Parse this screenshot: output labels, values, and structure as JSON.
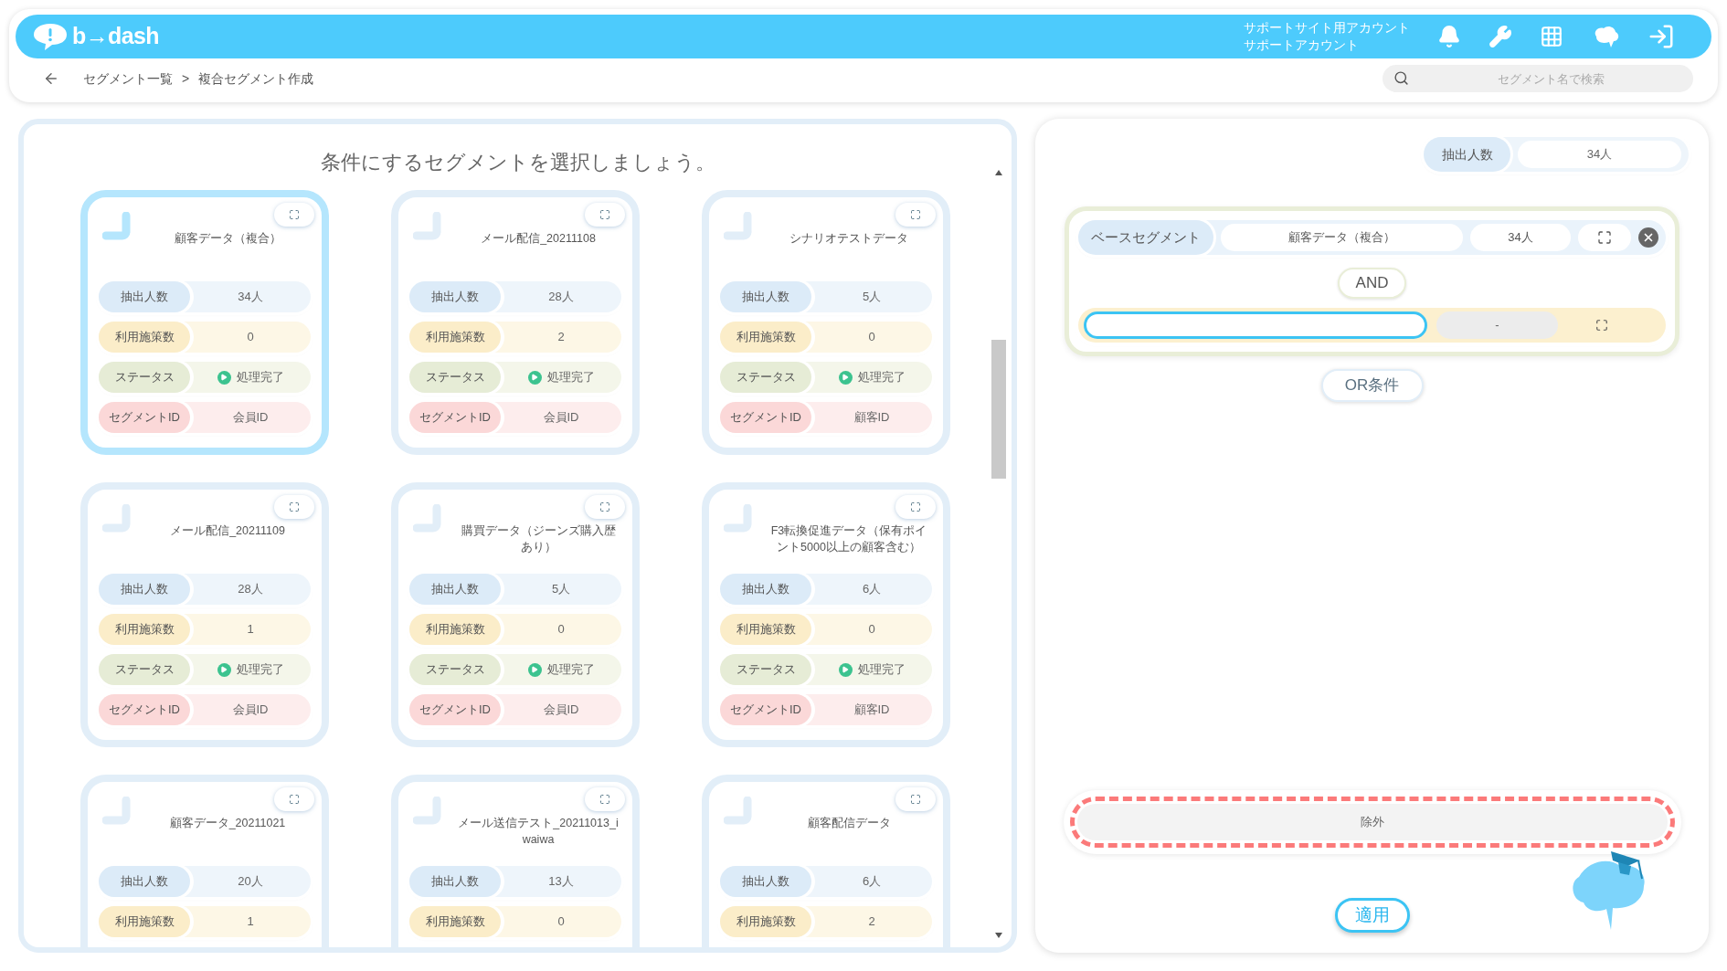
{
  "header": {
    "logo": "b→dash",
    "account_lines": [
      "サポートサイト用アカウント",
      "サポートアカウント"
    ]
  },
  "breadcrumb": {
    "items": [
      "セグメント一覧",
      "複合セグメント作成"
    ],
    "separator": ">"
  },
  "search": {
    "placeholder": "セグメント名で検索"
  },
  "segment_picker": {
    "title": "条件にするセグメントを選択しましょう。",
    "cards": [
      {
        "name": "顧客データ（複合）",
        "selected": true,
        "rows": [
          {
            "kind": "count",
            "label": "抽出人数",
            "value": "34人"
          },
          {
            "kind": "measures",
            "label": "利用施策数",
            "value": "0"
          },
          {
            "kind": "status",
            "label": "ステータス",
            "value": "処理完了"
          },
          {
            "kind": "id",
            "label": "セグメントID",
            "value": "会員ID"
          }
        ]
      },
      {
        "name": "メール配信_20211108",
        "selected": false,
        "rows": [
          {
            "kind": "count",
            "label": "抽出人数",
            "value": "28人"
          },
          {
            "kind": "measures",
            "label": "利用施策数",
            "value": "2"
          },
          {
            "kind": "status",
            "label": "ステータス",
            "value": "処理完了"
          },
          {
            "kind": "id",
            "label": "セグメントID",
            "value": "会員ID"
          }
        ]
      },
      {
        "name": "シナリオテストデータ",
        "selected": false,
        "rows": [
          {
            "kind": "count",
            "label": "抽出人数",
            "value": "5人"
          },
          {
            "kind": "measures",
            "label": "利用施策数",
            "value": "0"
          },
          {
            "kind": "status",
            "label": "ステータス",
            "value": "処理完了"
          },
          {
            "kind": "id",
            "label": "セグメントID",
            "value": "顧客ID"
          }
        ]
      },
      {
        "name": "メール配信_20211109",
        "selected": false,
        "rows": [
          {
            "kind": "count",
            "label": "抽出人数",
            "value": "28人"
          },
          {
            "kind": "measures",
            "label": "利用施策数",
            "value": "1"
          },
          {
            "kind": "status",
            "label": "ステータス",
            "value": "処理完了"
          },
          {
            "kind": "id",
            "label": "セグメントID",
            "value": "会員ID"
          }
        ]
      },
      {
        "name": "購買データ（ジーンズ購入歴あり）",
        "selected": false,
        "rows": [
          {
            "kind": "count",
            "label": "抽出人数",
            "value": "5人"
          },
          {
            "kind": "measures",
            "label": "利用施策数",
            "value": "0"
          },
          {
            "kind": "status",
            "label": "ステータス",
            "value": "処理完了"
          },
          {
            "kind": "id",
            "label": "セグメントID",
            "value": "会員ID"
          }
        ]
      },
      {
        "name": "F3転換促進データ（保有ポイント5000以上の顧客含む）",
        "selected": false,
        "rows": [
          {
            "kind": "count",
            "label": "抽出人数",
            "value": "6人"
          },
          {
            "kind": "measures",
            "label": "利用施策数",
            "value": "0"
          },
          {
            "kind": "status",
            "label": "ステータス",
            "value": "処理完了"
          },
          {
            "kind": "id",
            "label": "セグメントID",
            "value": "顧客ID"
          }
        ]
      },
      {
        "name": "顧客データ_20211021",
        "selected": false,
        "rows": [
          {
            "kind": "count",
            "label": "抽出人数",
            "value": "20人"
          },
          {
            "kind": "measures",
            "label": "利用施策数",
            "value": "1"
          }
        ]
      },
      {
        "name": "メール送信テスト_20211013_iwaiwa",
        "selected": false,
        "rows": [
          {
            "kind": "count",
            "label": "抽出人数",
            "value": "13人"
          },
          {
            "kind": "measures",
            "label": "利用施策数",
            "value": "0"
          }
        ]
      },
      {
        "name": "顧客配信データ",
        "selected": false,
        "rows": [
          {
            "kind": "count",
            "label": "抽出人数",
            "value": "6人"
          },
          {
            "kind": "measures",
            "label": "利用施策数",
            "value": "2"
          }
        ]
      }
    ]
  },
  "composer": {
    "total": {
      "label": "抽出人数",
      "value": "34人"
    },
    "base": {
      "label": "ベースセグメント",
      "segment": "顧客データ（複合）",
      "count": "34人"
    },
    "operator": "AND",
    "condition": {
      "count": "-"
    },
    "or_button": "OR条件",
    "exclude": {
      "label": "除外"
    },
    "apply_button": "適用"
  }
}
